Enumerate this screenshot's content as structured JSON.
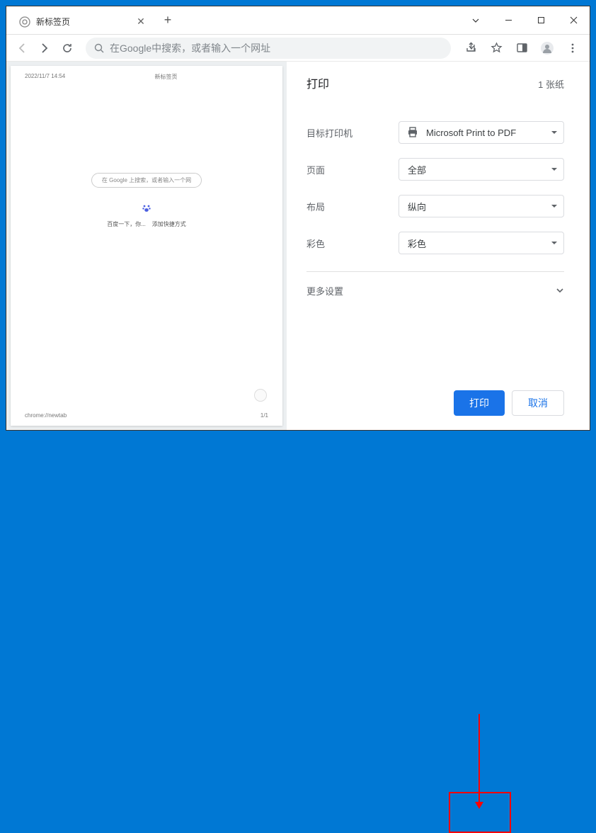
{
  "tab": {
    "title": "新标签页"
  },
  "address_placeholder": "在Google中搜索，或者输入一个网址",
  "preview": {
    "timestamp": "2022/11/7 14:54",
    "page_label": "新标签页",
    "search_placeholder": "在 Google 上搜索，或者输入一个网",
    "link1": "百度一下，你...",
    "link2": "添加快捷方式",
    "footer_url": "chrome://newtab",
    "footer_page": "1/1"
  },
  "print": {
    "title": "打印",
    "sheets": "1 张纸",
    "destination_label": "目标打印机",
    "destination_value": "Microsoft Print to PDF",
    "pages_label": "页面",
    "pages_value": "全部",
    "layout_label": "布局",
    "layout_value": "纵向",
    "color_label": "彩色",
    "color_value": "彩色",
    "more": "更多设置",
    "print_btn": "打印",
    "cancel_btn": "取消"
  }
}
